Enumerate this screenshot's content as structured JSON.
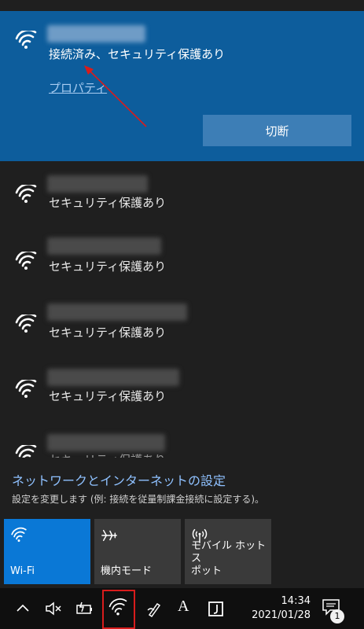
{
  "connected": {
    "status": "接続済み、セキュリティ保護あり",
    "properties": "プロパティ",
    "disconnect": "切断"
  },
  "networks": [
    {
      "status": "セキュリティ保護あり"
    },
    {
      "status": "セキュリティ保護あり"
    },
    {
      "status": "セキュリティ保護あり"
    },
    {
      "status": "セキュリティ保護あり"
    },
    {
      "status": "セキュリティ保護あり"
    }
  ],
  "settings": {
    "title": "ネットワークとインターネットの設定",
    "subtitle": "設定を変更します (例: 接続を従量制課金接続に設定する)。"
  },
  "tiles": {
    "wifi": "Wi-Fi",
    "airplane": "機内モード",
    "hotspot_line1": "モバイル ホットス",
    "hotspot_line2": "ポット"
  },
  "taskbar": {
    "ime": "A",
    "time": "14:34",
    "date": "2021/01/28",
    "notifications": "1"
  },
  "colors": {
    "accent": "#0d5d9c",
    "tile_active": "#0a78d6",
    "link": "#8fc1ff",
    "highlight_box": "#d81c1c"
  }
}
